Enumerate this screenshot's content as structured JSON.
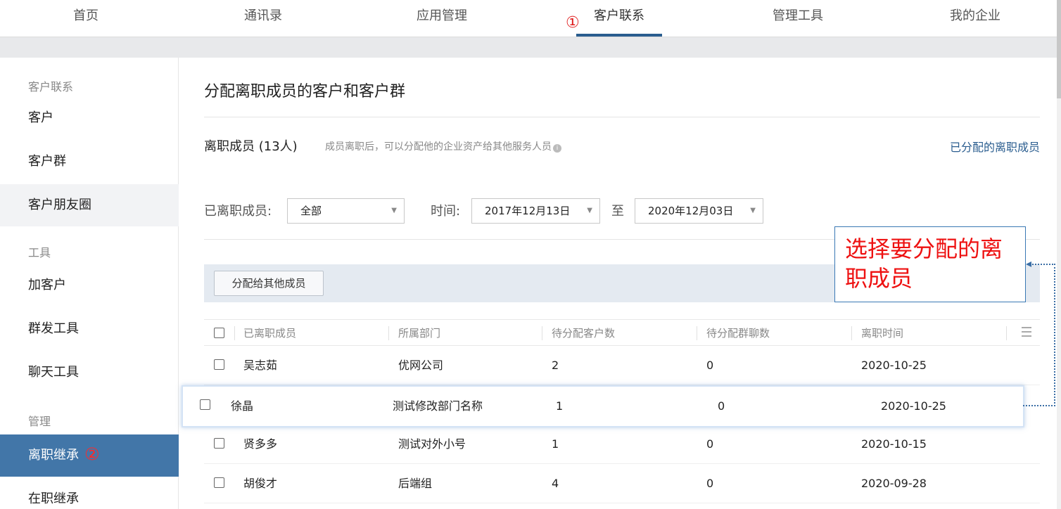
{
  "nav": {
    "items": [
      {
        "label": "首页"
      },
      {
        "label": "通讯录"
      },
      {
        "label": "应用管理"
      },
      {
        "label": "客户联系"
      },
      {
        "label": "管理工具"
      },
      {
        "label": "我的企业"
      }
    ],
    "active_index": 3,
    "step_marker": "①"
  },
  "sidebar": {
    "group_contact": "客户联系",
    "item_customer": "客户",
    "item_customer_group": "客户群",
    "item_moments": "客户朋友圈",
    "group_tools": "工具",
    "item_add_customer": "加客户",
    "item_broadcast": "群发工具",
    "item_chat_tools": "聊天工具",
    "group_manage": "管理",
    "item_resigned_inherit": "离职继承",
    "step_marker": "②",
    "item_active_inherit": "在职继承"
  },
  "main": {
    "title": "分配离职成员的客户和客户群",
    "count_label": "离职成员 (13人)",
    "count_hint": "成员离职后，可以分配他的企业资产给其他服务人员",
    "info_icon": "i",
    "assigned_link": "已分配的离职成员",
    "filter": {
      "member_label": "已离职成员:",
      "member_value": "全部",
      "time_label": "时间:",
      "date_from": "2017年12月13日",
      "to_label": "至",
      "date_to": "2020年12月03日"
    },
    "assign_button": "分配给其他成员",
    "callout_text": "选择要分配的离职成员",
    "table": {
      "headers": [
        "已离职成员",
        "所属部门",
        "待分配客户数",
        "待分配群聊数",
        "离职时间"
      ],
      "rows": [
        {
          "name": "吴志茹",
          "dept": "优网公司",
          "customers": "2",
          "groups": "0",
          "date": "2020-10-25"
        },
        {
          "name": "徐晶",
          "dept": "测试修改部门名称",
          "customers": "1",
          "groups": "0",
          "date": "2020-10-25"
        },
        {
          "name": "贤多多",
          "dept": "测试对外小号",
          "customers": "1",
          "groups": "0",
          "date": "2020-10-15"
        },
        {
          "name": "胡俊才",
          "dept": "后端组",
          "customers": "4",
          "groups": "0",
          "date": "2020-09-28"
        }
      ]
    }
  }
}
